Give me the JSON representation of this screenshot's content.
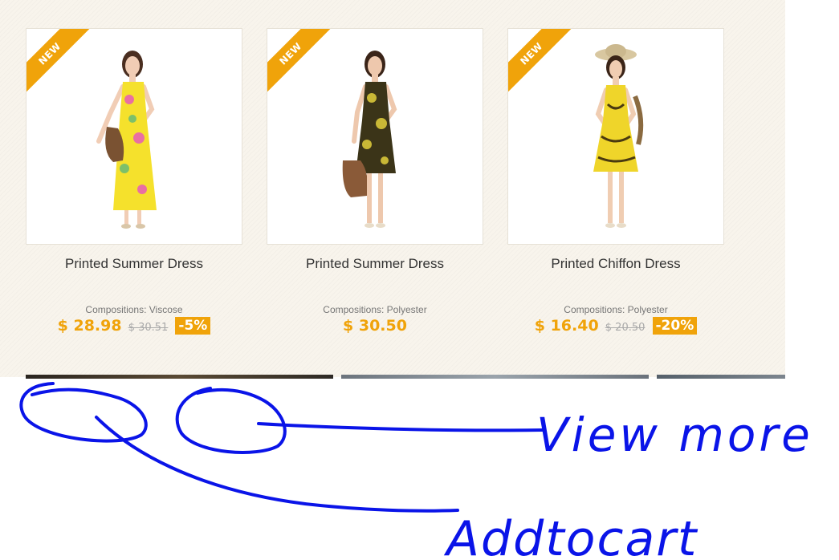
{
  "products": [
    {
      "badge": "NEW",
      "name": "Printed Summer Dress",
      "composition": "Compositions: Viscose",
      "price": "$ 28.98",
      "old_price": "$ 30.51",
      "discount": "-5%",
      "dress_colors": [
        "#f5e12c",
        "#e96fa3",
        "#7cc06a"
      ]
    },
    {
      "badge": "NEW",
      "name": "Printed Summer Dress",
      "composition": "Compositions: Polyester",
      "price": "$ 30.50",
      "old_price": "",
      "discount": "",
      "dress_colors": [
        "#3b3418",
        "#c9b836"
      ]
    },
    {
      "badge": "NEW",
      "name": "Printed Chiffon Dress",
      "composition": "Compositions: Polyester",
      "price": "$ 16.40",
      "old_price": "$ 20.50",
      "discount": "-20%",
      "dress_colors": [
        "#efd52a",
        "#4a3a10"
      ]
    }
  ],
  "annotations": {
    "view_more": "View more",
    "add_to_cart": "Addtocart",
    "ink_color": "#0a14e8"
  },
  "theme": {
    "accent": "#f0a30a",
    "background": "#f8f4ec"
  }
}
